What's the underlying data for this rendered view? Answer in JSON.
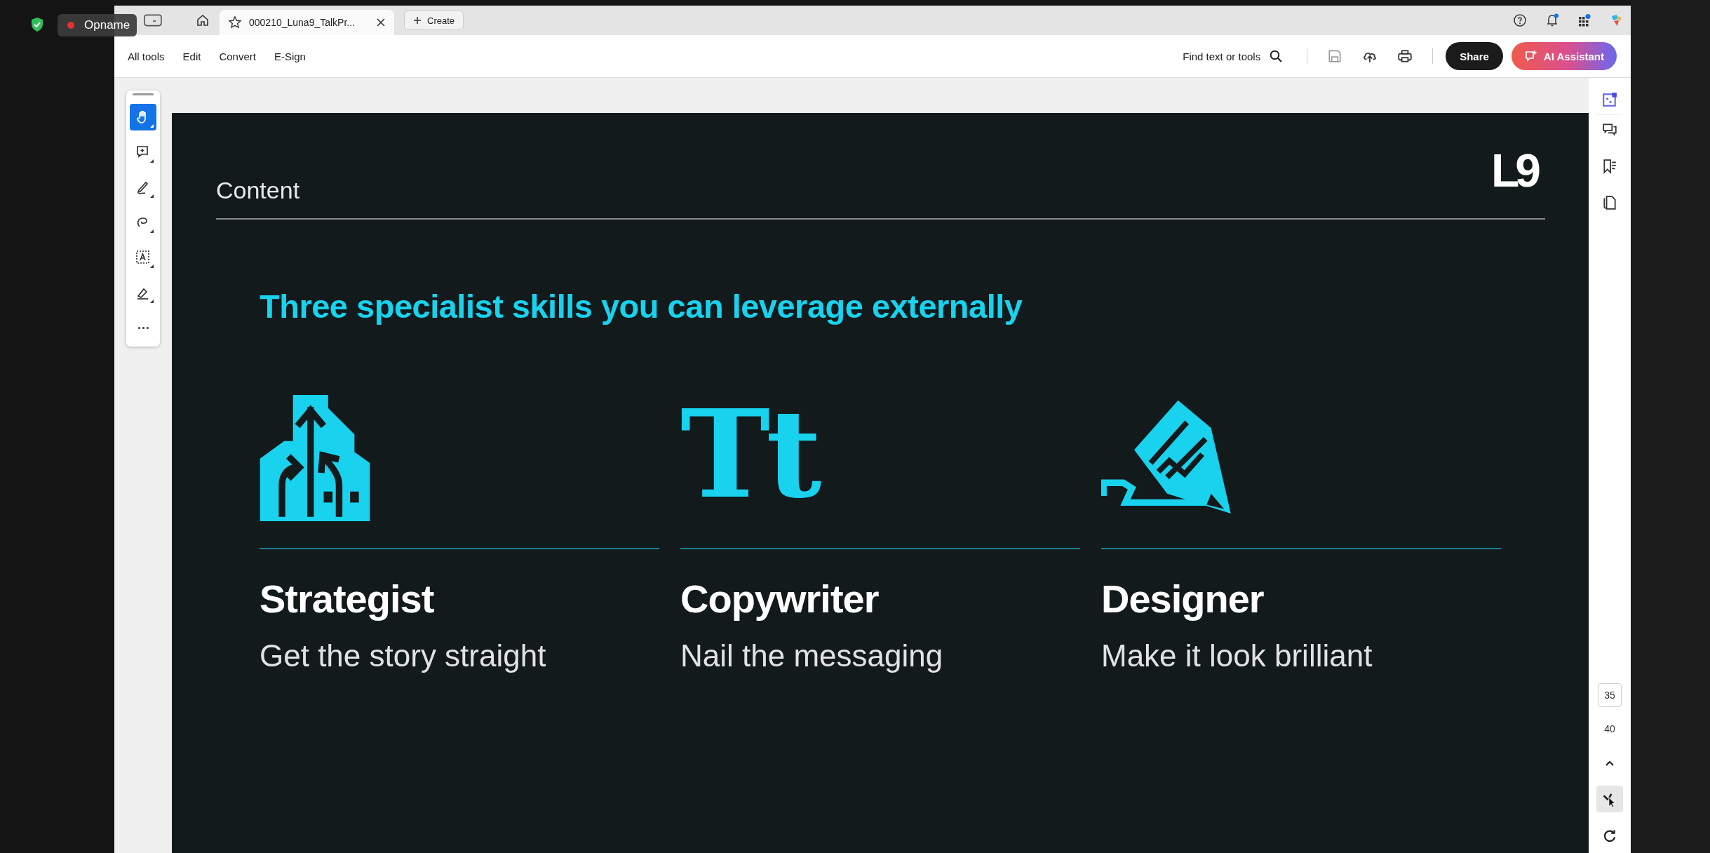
{
  "overlay": {
    "recording_label": "Opname"
  },
  "tabs": [
    {
      "title": "000210_Luna9_TalkPr...",
      "selected": true
    }
  ],
  "create_button": "Create",
  "menu": [
    "All tools",
    "Edit",
    "Convert",
    "E-Sign"
  ],
  "search": {
    "placeholder": "Find text or tools"
  },
  "share_button": "Share",
  "ai_button": "AI Assistant",
  "tools": [
    {
      "kind": "hand",
      "selected": true
    },
    {
      "kind": "comment",
      "selected": false
    },
    {
      "kind": "pen",
      "selected": false
    },
    {
      "kind": "lasso",
      "selected": false
    },
    {
      "kind": "textbox",
      "selected": false
    },
    {
      "kind": "sign",
      "selected": false
    },
    {
      "kind": "more",
      "selected": false
    }
  ],
  "slide": {
    "section": "Content",
    "logo": "L9",
    "heading": "Three specialist skills you can leverage externally",
    "skills": [
      {
        "kind": "strategy",
        "title": "Strategist",
        "subtitle": "Get the story straight"
      },
      {
        "kind": "type",
        "glyph": "Tt",
        "title": "Copywriter",
        "subtitle": "Nail the messaging"
      },
      {
        "kind": "pencil",
        "title": "Designer",
        "subtitle": "Make it look brilliant"
      }
    ]
  },
  "page_numbers": [
    {
      "label": "35",
      "selected": true
    },
    {
      "label": "40",
      "selected": false
    }
  ]
}
